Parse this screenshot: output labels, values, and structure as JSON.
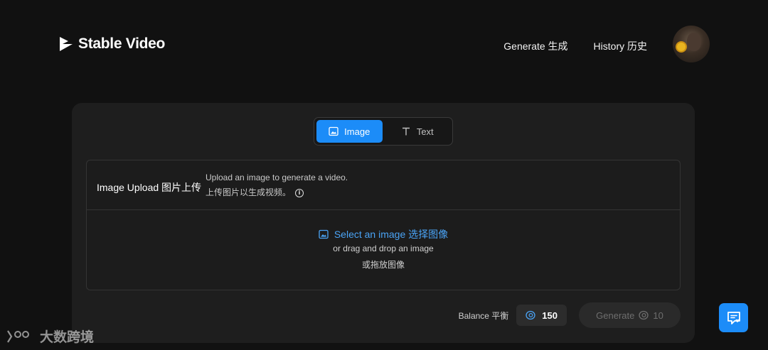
{
  "header": {
    "brand": "Stable Video",
    "nav": [
      {
        "label": "Generate 生成"
      },
      {
        "label": "History 历史"
      }
    ]
  },
  "tabs": [
    {
      "label": "Image",
      "icon": "image-icon",
      "active": true
    },
    {
      "label": "Text",
      "icon": "text-icon",
      "active": false
    }
  ],
  "upload": {
    "title": "Image Upload 图片上传",
    "description_en": "Upload an image to generate a video.",
    "description_cn": "上传图片以生成视频。",
    "select_label": "Select an image 选择图像",
    "drag_hint": "or drag and drop an image",
    "drag_hint_cn": "或拖放图像"
  },
  "footer": {
    "balance_label": "Balance 平衡",
    "balance_value": "150",
    "generate_label": "Generate",
    "generate_cost": "10"
  },
  "watermark": "大数跨境",
  "colors": {
    "accent": "#1c8cf8",
    "link": "#4aa3f5",
    "background": "#111111",
    "panel": "#1e1e1e"
  }
}
